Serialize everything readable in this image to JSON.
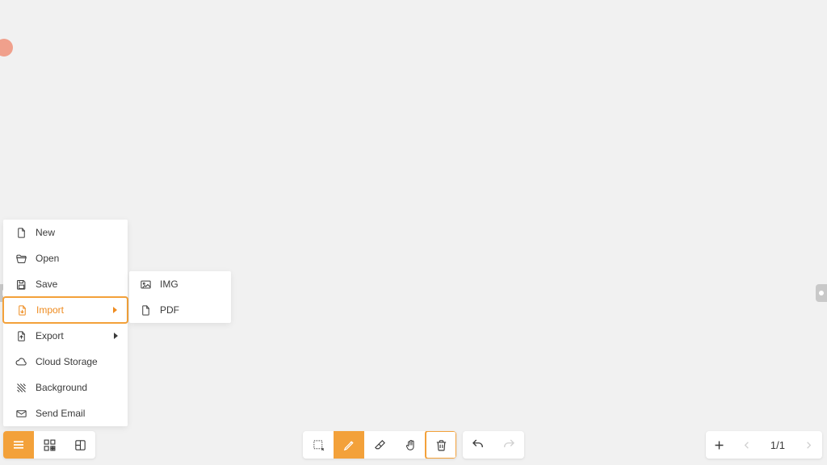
{
  "menu": {
    "items": [
      {
        "label": "New"
      },
      {
        "label": "Open"
      },
      {
        "label": "Save"
      },
      {
        "label": "Import"
      },
      {
        "label": "Export"
      },
      {
        "label": "Cloud Storage"
      },
      {
        "label": "Background"
      },
      {
        "label": "Send Email"
      }
    ]
  },
  "submenu": {
    "items": [
      {
        "label": "IMG"
      },
      {
        "label": "PDF"
      }
    ]
  },
  "pager": {
    "text": "1/1"
  }
}
